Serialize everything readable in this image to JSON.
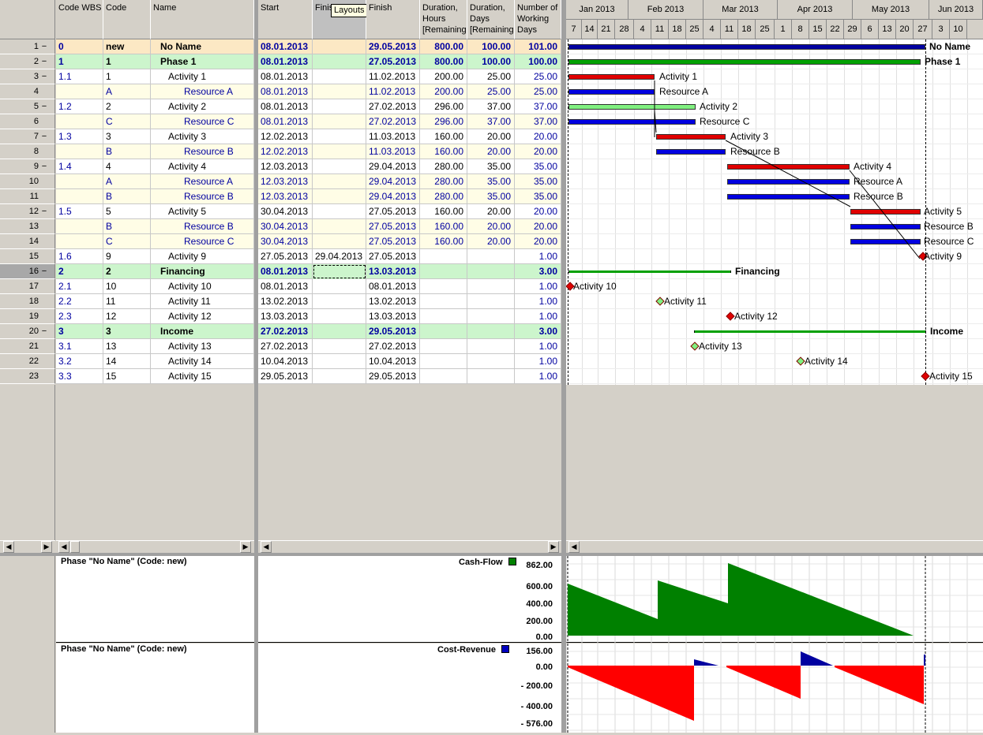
{
  "headers": {
    "code_wbs": "Code WBS",
    "code": "Code",
    "name": "Name",
    "start": "Start",
    "finish_planned": "Finis",
    "finish": "Finish",
    "dur_hours": "Duration,\nHours\n[Remaining",
    "dur_days": "Duration,\nDays\n[Remaining",
    "working_days": "Number of\nWorking\nDays"
  },
  "tooltip": "Layouts",
  "months": [
    "Jan 2013",
    "Feb 2013",
    "Mar 2013",
    "Apr 2013",
    "May 2013",
    "Jun 2013"
  ],
  "days": [
    "7",
    "14",
    "21",
    "28",
    "4",
    "11",
    "18",
    "25",
    "4",
    "11",
    "18",
    "25",
    "1",
    "8",
    "15",
    "22",
    "29",
    "6",
    "13",
    "20",
    "27",
    "3",
    "10"
  ],
  "rows": [
    {
      "n": "1",
      "c": "−",
      "wbs": "0",
      "code": "new",
      "name": "No Name",
      "start": "08.01.2013",
      "fp": "",
      "finish": "29.05.2013",
      "hours": "800.00",
      "days": "100.00",
      "wd": "101.00",
      "type": "root"
    },
    {
      "n": "2",
      "c": "−",
      "wbs": "1",
      "code": "1",
      "name": "Phase 1",
      "start": "08.01.2013",
      "fp": "",
      "finish": "27.05.2013",
      "hours": "800.00",
      "days": "100.00",
      "wd": "100.00",
      "type": "phase"
    },
    {
      "n": "3",
      "c": "−",
      "wbs": "1.1",
      "code": "1",
      "name": "Activity 1",
      "start": "08.01.2013",
      "fp": "",
      "finish": "11.02.2013",
      "hours": "200.00",
      "days": "25.00",
      "wd": "25.00",
      "type": "act"
    },
    {
      "n": "4",
      "c": "",
      "wbs": "",
      "code": "A",
      "name": "Resource A",
      "start": "08.01.2013",
      "fp": "",
      "finish": "11.02.2013",
      "hours": "200.00",
      "days": "25.00",
      "wd": "25.00",
      "type": "res"
    },
    {
      "n": "5",
      "c": "−",
      "wbs": "1.2",
      "code": "2",
      "name": "Activity 2",
      "start": "08.01.2013",
      "fp": "",
      "finish": "27.02.2013",
      "hours": "296.00",
      "days": "37.00",
      "wd": "37.00",
      "type": "act"
    },
    {
      "n": "6",
      "c": "",
      "wbs": "",
      "code": "C",
      "name": "Resource C",
      "start": "08.01.2013",
      "fp": "",
      "finish": "27.02.2013",
      "hours": "296.00",
      "days": "37.00",
      "wd": "37.00",
      "type": "res"
    },
    {
      "n": "7",
      "c": "−",
      "wbs": "1.3",
      "code": "3",
      "name": "Activity 3",
      "start": "12.02.2013",
      "fp": "",
      "finish": "11.03.2013",
      "hours": "160.00",
      "days": "20.00",
      "wd": "20.00",
      "type": "act"
    },
    {
      "n": "8",
      "c": "",
      "wbs": "",
      "code": "B",
      "name": "Resource B",
      "start": "12.02.2013",
      "fp": "",
      "finish": "11.03.2013",
      "hours": "160.00",
      "days": "20.00",
      "wd": "20.00",
      "type": "res"
    },
    {
      "n": "9",
      "c": "−",
      "wbs": "1.4",
      "code": "4",
      "name": "Activity 4",
      "start": "12.03.2013",
      "fp": "",
      "finish": "29.04.2013",
      "hours": "280.00",
      "days": "35.00",
      "wd": "35.00",
      "type": "act"
    },
    {
      "n": "10",
      "c": "",
      "wbs": "",
      "code": "A",
      "name": "Resource A",
      "start": "12.03.2013",
      "fp": "",
      "finish": "29.04.2013",
      "hours": "280.00",
      "days": "35.00",
      "wd": "35.00",
      "type": "res"
    },
    {
      "n": "11",
      "c": "",
      "wbs": "",
      "code": "B",
      "name": "Resource B",
      "start": "12.03.2013",
      "fp": "",
      "finish": "29.04.2013",
      "hours": "280.00",
      "days": "35.00",
      "wd": "35.00",
      "type": "res"
    },
    {
      "n": "12",
      "c": "−",
      "wbs": "1.5",
      "code": "5",
      "name": "Activity 5",
      "start": "30.04.2013",
      "fp": "",
      "finish": "27.05.2013",
      "hours": "160.00",
      "days": "20.00",
      "wd": "20.00",
      "type": "act"
    },
    {
      "n": "13",
      "c": "",
      "wbs": "",
      "code": "B",
      "name": "Resource B",
      "start": "30.04.2013",
      "fp": "",
      "finish": "27.05.2013",
      "hours": "160.00",
      "days": "20.00",
      "wd": "20.00",
      "type": "res"
    },
    {
      "n": "14",
      "c": "",
      "wbs": "",
      "code": "C",
      "name": "Resource C",
      "start": "30.04.2013",
      "fp": "",
      "finish": "27.05.2013",
      "hours": "160.00",
      "days": "20.00",
      "wd": "20.00",
      "type": "res"
    },
    {
      "n": "15",
      "c": "",
      "wbs": "1.6",
      "code": "9",
      "name": "Activity 9",
      "start": "27.05.2013",
      "fp": "29.04.2013",
      "finish": "27.05.2013",
      "hours": "",
      "days": "",
      "wd": "1.00",
      "type": "act"
    },
    {
      "n": "16",
      "c": "−",
      "wbs": "2",
      "code": "2",
      "name": "Financing",
      "start": "08.01.2013",
      "fp": "",
      "finish": "13.03.2013",
      "hours": "",
      "days": "",
      "wd": "3.00",
      "type": "phase"
    },
    {
      "n": "17",
      "c": "",
      "wbs": "2.1",
      "code": "10",
      "name": "Activity 10",
      "start": "08.01.2013",
      "fp": "",
      "finish": "08.01.2013",
      "hours": "",
      "days": "",
      "wd": "1.00",
      "type": "act"
    },
    {
      "n": "18",
      "c": "",
      "wbs": "2.2",
      "code": "11",
      "name": "Activity 11",
      "start": "13.02.2013",
      "fp": "",
      "finish": "13.02.2013",
      "hours": "",
      "days": "",
      "wd": "1.00",
      "type": "act"
    },
    {
      "n": "19",
      "c": "",
      "wbs": "2.3",
      "code": "12",
      "name": "Activity 12",
      "start": "13.03.2013",
      "fp": "",
      "finish": "13.03.2013",
      "hours": "",
      "days": "",
      "wd": "1.00",
      "type": "act"
    },
    {
      "n": "20",
      "c": "−",
      "wbs": "3",
      "code": "3",
      "name": "Income",
      "start": "27.02.2013",
      "fp": "",
      "finish": "29.05.2013",
      "hours": "",
      "days": "",
      "wd": "3.00",
      "type": "phase"
    },
    {
      "n": "21",
      "c": "",
      "wbs": "3.1",
      "code": "13",
      "name": "Activity 13",
      "start": "27.02.2013",
      "fp": "",
      "finish": "27.02.2013",
      "hours": "",
      "days": "",
      "wd": "1.00",
      "type": "act"
    },
    {
      "n": "22",
      "c": "",
      "wbs": "3.2",
      "code": "14",
      "name": "Activity 14",
      "start": "10.04.2013",
      "fp": "",
      "finish": "10.04.2013",
      "hours": "",
      "days": "",
      "wd": "1.00",
      "type": "act"
    },
    {
      "n": "23",
      "c": "",
      "wbs": "3.3",
      "code": "15",
      "name": "Activity 15",
      "start": "29.05.2013",
      "fp": "",
      "finish": "29.05.2013",
      "hours": "",
      "days": "",
      "wd": "1.00",
      "type": "act"
    }
  ],
  "gantt_labels": [
    "No Name",
    "Phase 1",
    "Activity 1",
    "Resource A",
    "Activity 2",
    "Resource C",
    "Activity 3",
    "Resource B",
    "Activity 4",
    "Resource A",
    "Resource B",
    "Activity 5",
    "Resource B",
    "Resource C",
    "Activity 9",
    "Financing",
    "Activity 10",
    "Activity 11",
    "Activity 12",
    "Income",
    "Activity 13",
    "Activity 14",
    "Activity 15"
  ],
  "panel1": {
    "title": "Phase \"No Name\" (Code: new)",
    "legend": "Cash-Flow",
    "ticks": [
      "862.00",
      "600.00",
      "400.00",
      "200.00",
      "0.00"
    ],
    "color": "#008000"
  },
  "panel2": {
    "title": "Phase \"No Name\" (Code: new)",
    "legend": "Cost-Revenue",
    "ticks": [
      "156.00",
      "0.00",
      "- 200.00",
      "- 400.00",
      "- 576.00"
    ],
    "neg_color": "#ff0000",
    "pos_color": "#0000a0"
  }
}
